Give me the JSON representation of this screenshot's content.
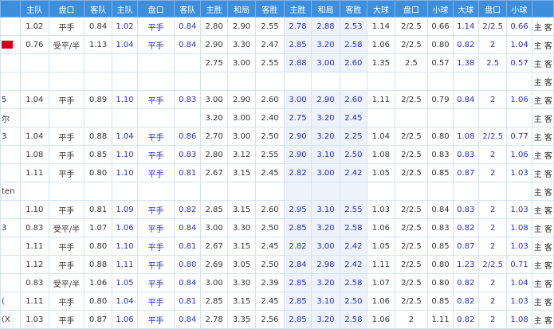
{
  "headers": [
    "",
    "主队",
    "盘口",
    "客队",
    "主队",
    "盘口",
    "客队",
    "主胜",
    "和局",
    "客胜",
    "主胜",
    "和局",
    "客胜",
    "大球",
    "盘口",
    "小球",
    "大球",
    "盘口",
    "小球"
  ],
  "last_col_text": "主 客",
  "rows": [
    {
      "first": "",
      "cells": [
        "1.02",
        "平手",
        "0.84",
        "1.02",
        "平手",
        "0.84",
        "2.80",
        "2.90",
        "2.55",
        "2.78",
        "2.88",
        "2.53",
        "1.14",
        "2/2.5",
        "0.66",
        "1.14",
        "2/2.5",
        "0.66"
      ]
    },
    {
      "first": "",
      "red": true,
      "cells": [
        "0.76",
        "受平/半",
        "1.13",
        "1.04",
        "平手",
        "0.84",
        "2.90",
        "3.30",
        "2.47",
        "2.85",
        "3.20",
        "2.58",
        "1.06",
        "2/2.5",
        "0.80",
        "0.82",
        "2",
        "1.04"
      ]
    },
    {
      "first": "",
      "cells": [
        "",
        "",
        "",
        "",
        "",
        "",
        "2.75",
        "3.00",
        "2.55",
        "2.88",
        "3.00",
        "2.60",
        "1.35",
        "2.5",
        "0.57",
        "1.38",
        "2.5",
        "0.57"
      ]
    },
    {
      "first": "",
      "sep": true
    },
    {
      "first": "5",
      "cells": [
        "1.04",
        "平手",
        "0.89",
        "1.10",
        "平手",
        "0.83",
        "3.00",
        "2.90",
        "2.60",
        "3.00",
        "2.90",
        "2.60",
        "1.11",
        "2/2.5",
        "0.79",
        "0.84",
        "2",
        "1.06"
      ]
    },
    {
      "first": "尔",
      "cells": [
        "",
        "",
        "",
        "",
        "",
        "",
        "3.20",
        "3.00",
        "2.40",
        "2.75",
        "3.20",
        "2.45",
        "",
        "",
        "",
        "",
        "",
        ""
      ]
    },
    {
      "first": "3",
      "cells": [
        "1.04",
        "平手",
        "0.88",
        "1.04",
        "平手",
        "0.86",
        "2.70",
        "3.00",
        "2.50",
        "2.90",
        "3.20",
        "2.25",
        "1.04",
        "2/2.5",
        "0.80",
        "1.08",
        "2/2.5",
        "0.77"
      ]
    },
    {
      "first": "",
      "cells": [
        "1.08",
        "平手",
        "0.85",
        "1.10",
        "平手",
        "0.83",
        "2.80",
        "3.12",
        "2.55",
        "2.90",
        "3.10",
        "2.50",
        "1.08",
        "2/2.5",
        "0.83",
        "0.83",
        "2",
        "1.06"
      ]
    },
    {
      "first": "",
      "cells": [
        "1.11",
        "平手",
        "0.80",
        "1.10",
        "平手",
        "0.81",
        "2.67",
        "3.15",
        "2.45",
        "2.82",
        "3.00",
        "2.42",
        "1.05",
        "2/2.5",
        "0.85",
        "0.87",
        "2",
        "1.03"
      ]
    },
    {
      "first": "ten",
      "cells": [
        "",
        "",
        "",
        "",
        "",
        "",
        "",
        "",
        "",
        "",
        "",
        "",
        "",
        "",
        "",
        "",
        "",
        ""
      ]
    },
    {
      "first": "",
      "cells": [
        "1.10",
        "平手",
        "0.81",
        "1.09",
        "平手",
        "0.82",
        "2.85",
        "3.15",
        "2.60",
        "2.95",
        "3.10",
        "2.55",
        "1.03",
        "2/2.5",
        "0.84",
        "0.83",
        "2",
        "1.03"
      ]
    },
    {
      "first": "3",
      "cells": [
        "0.83",
        "受平/半",
        "1.07",
        "1.06",
        "平手",
        "0.84",
        "3.00",
        "3.30",
        "2.50",
        "2.85",
        "3.20",
        "2.58",
        "1.06",
        "2/2.5",
        "0.83",
        "0.82",
        "2",
        "1.08"
      ]
    },
    {
      "first": "",
      "cells": [
        "1.11",
        "平手",
        "0.80",
        "1.10",
        "平手",
        "0.81",
        "2.67",
        "3.15",
        "2.45",
        "2.82",
        "3.00",
        "2.42",
        "1.05",
        "2/2.5",
        "0.85",
        "0.87",
        "2",
        "1.03"
      ]
    },
    {
      "first": "",
      "cells": [
        "1.12",
        "平手",
        "0.88",
        "1.11",
        "平手",
        "0.80",
        "2.69",
        "3.05",
        "2.50",
        "2.84",
        "2.98",
        "2.42",
        "1.11",
        "2/2.5",
        "0.80",
        "1.23",
        "2/2.5",
        "0.71"
      ]
    },
    {
      "first": "",
      "cells": [
        "0.83",
        "受平/半",
        "1.06",
        "1.05",
        "平手",
        "0.84",
        "3.00",
        "3.30",
        "2.39",
        "2.85",
        "3.20",
        "2.58",
        "1.07",
        "2/2.5",
        "0.80",
        "0.82",
        "2",
        "1.04"
      ]
    },
    {
      "first": "(",
      "cells": [
        "1.11",
        "平手",
        "0.80",
        "1.04",
        "平手",
        "0.81",
        "2.85",
        "3.15",
        "2.45",
        "2.85",
        "3.10",
        "2.50",
        "1.06",
        "2/2.5",
        "0.85",
        "0.82",
        "2",
        "1.03"
      ]
    },
    {
      "first": "(X",
      "cells": [
        "1.03",
        "平手",
        "0.87",
        "1.06",
        "平手",
        "0.84",
        "2.78",
        "3.35",
        "2.56",
        "2.85",
        "3.20",
        "2.58",
        "1.06",
        "2",
        "1.11",
        "0.82",
        "2",
        "1.08"
      ]
    }
  ]
}
